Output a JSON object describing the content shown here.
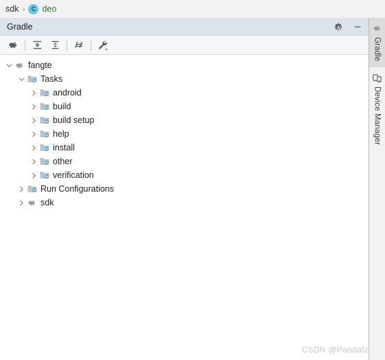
{
  "breadcrumb": {
    "root_label": "sdk",
    "separator": "›",
    "class_icon_letter": "C",
    "class_label": "deo"
  },
  "toolwindow": {
    "title": "Gradle",
    "header_actions": [
      {
        "name": "gear-icon",
        "tooltip": "Settings"
      },
      {
        "name": "minimize-icon",
        "tooltip": "Hide"
      }
    ],
    "toolbar": [
      {
        "name": "gradle-elephant-icon",
        "tooltip": "Reload All Gradle Projects"
      },
      {
        "name": "expand-all-icon",
        "tooltip": "Expand All"
      },
      {
        "name": "collapse-all-icon",
        "tooltip": "Collapse All"
      },
      {
        "name": "toggle-offline-icon",
        "tooltip": "Toggle Offline Mode"
      },
      {
        "name": "build-tool-settings-icon",
        "tooltip": "Gradle Settings"
      }
    ]
  },
  "tree": {
    "nodes": [
      {
        "label": "fangte",
        "depth": 0,
        "state": "expanded",
        "icon": "gradle-elephant-icon"
      },
      {
        "label": "Tasks",
        "depth": 1,
        "state": "expanded",
        "icon": "task-folder-icon"
      },
      {
        "label": "android",
        "depth": 2,
        "state": "collapsed",
        "icon": "task-folder-icon"
      },
      {
        "label": "build",
        "depth": 2,
        "state": "collapsed",
        "icon": "task-folder-icon"
      },
      {
        "label": "build setup",
        "depth": 2,
        "state": "collapsed",
        "icon": "task-folder-icon"
      },
      {
        "label": "help",
        "depth": 2,
        "state": "collapsed",
        "icon": "task-folder-icon"
      },
      {
        "label": "install",
        "depth": 2,
        "state": "collapsed",
        "icon": "task-folder-icon"
      },
      {
        "label": "other",
        "depth": 2,
        "state": "collapsed",
        "icon": "task-folder-icon"
      },
      {
        "label": "verification",
        "depth": 2,
        "state": "collapsed",
        "icon": "task-folder-icon"
      },
      {
        "label": "Run Configurations",
        "depth": 1,
        "state": "collapsed",
        "icon": "task-folder-icon"
      },
      {
        "label": "sdk",
        "depth": 1,
        "state": "collapsed",
        "icon": "gradle-elephant-icon"
      }
    ]
  },
  "rail": {
    "tabs": [
      {
        "label": "Gradle",
        "icon": "gradle-elephant-icon",
        "active": true
      },
      {
        "label": "Device Manager",
        "icon": "device-manager-icon",
        "active": false
      }
    ]
  },
  "watermark": {
    "text": "CSDN @Pandafz"
  },
  "colors": {
    "header_bg": "#dde3ea",
    "toolbar_bg": "#f6f7f8",
    "panel_bg": "#ffffff",
    "chrome_bg": "#f2f2f2",
    "class_icon": "#66c9e8",
    "gear_overlay": "#3b9fd6",
    "folder_gray": "#9aa7b0",
    "text": "#1d1d1d",
    "watermark": "#c9c9c9"
  }
}
